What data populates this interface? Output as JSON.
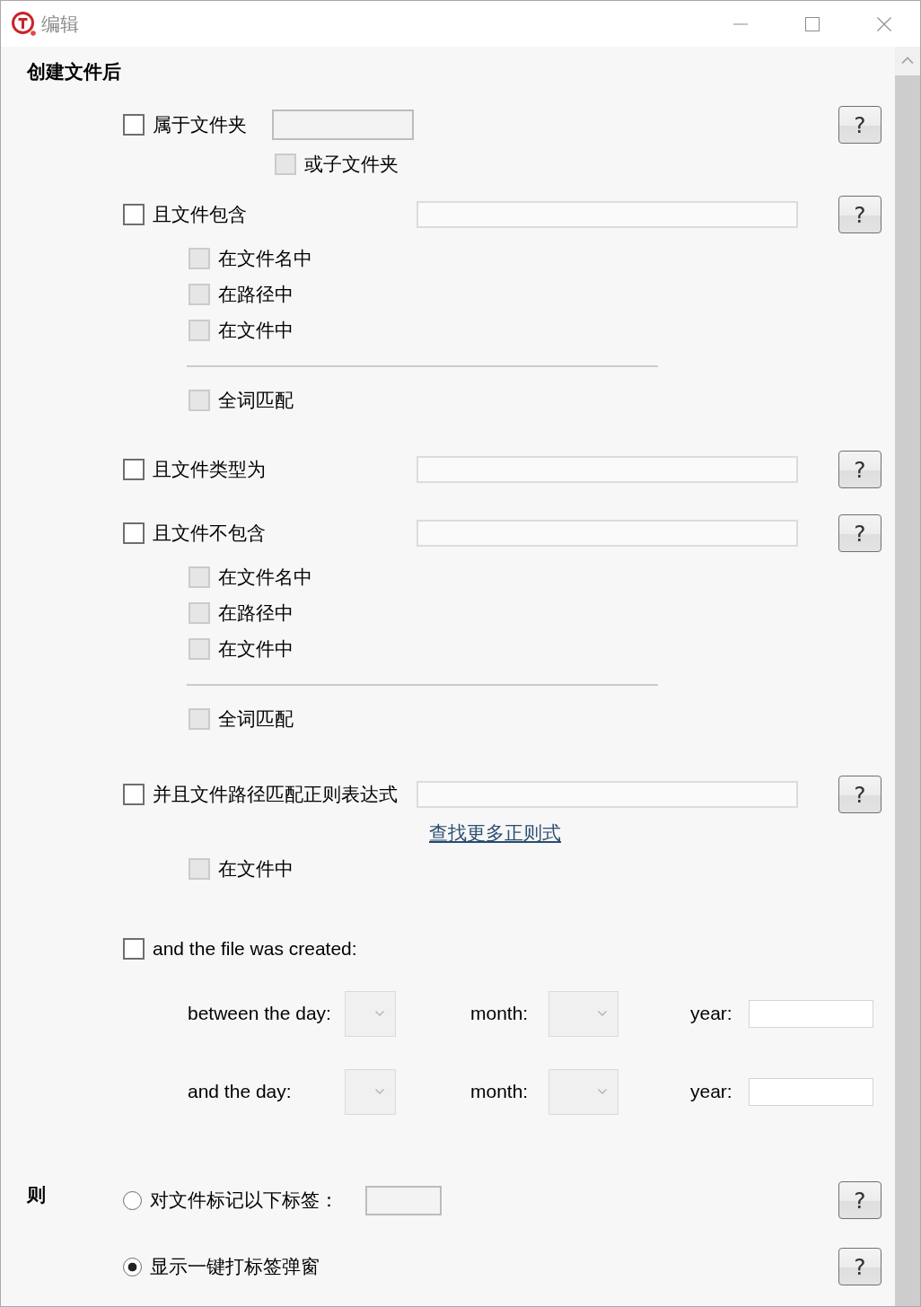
{
  "window": {
    "title": "编辑"
  },
  "created": {
    "heading": "创建文件后",
    "conditions": [
      {
        "kind": "folder",
        "label": "属于文件夹",
        "checked": false,
        "field": {
          "disabled": true
        },
        "help": "?",
        "subfolder": {
          "label": "或子文件夹",
          "checked": false,
          "disabled": true
        }
      },
      {
        "kind": "contains",
        "label": "且文件包含",
        "checked": false,
        "field": {
          "disabled": false
        },
        "help": "?",
        "options": [
          {
            "label": "在文件名中",
            "checked": false,
            "disabled": true
          },
          {
            "label": "在路径中",
            "checked": false,
            "disabled": true
          },
          {
            "label": "在文件中",
            "checked": false,
            "disabled": true
          }
        ],
        "whole_word": {
          "label": "全词匹配",
          "checked": false,
          "disabled": true
        }
      },
      {
        "kind": "type",
        "label": "且文件类型为",
        "checked": false,
        "field": {
          "disabled": false
        },
        "help": "?"
      },
      {
        "kind": "contains",
        "label": "且文件不包含",
        "checked": false,
        "field": {
          "disabled": false
        },
        "help": "?",
        "options": [
          {
            "label": "在文件名中",
            "checked": false,
            "disabled": true
          },
          {
            "label": "在路径中",
            "checked": false,
            "disabled": true
          },
          {
            "label": "在文件中",
            "checked": false,
            "disabled": true
          }
        ],
        "whole_word": {
          "label": "全词匹配",
          "checked": false,
          "disabled": true
        }
      },
      {
        "kind": "regex",
        "label": "并且文件路径匹配正则表达式",
        "checked": false,
        "field": {
          "disabled": false
        },
        "help": "?",
        "link": "查找更多正则式",
        "options": [
          {
            "label": "在文件中",
            "checked": false,
            "disabled": true
          }
        ]
      },
      {
        "kind": "date",
        "label": "and the file was created:",
        "checked": false,
        "ranges": [
          {
            "day": {
              "label": "between the day:",
              "disabled": true
            },
            "month": {
              "label": "month:",
              "disabled": true
            },
            "year": {
              "label": "year:"
            }
          },
          {
            "day": {
              "label": "and the day:",
              "disabled": true
            },
            "month": {
              "label": "month:",
              "disabled": true
            },
            "year": {
              "label": "year:"
            }
          }
        ]
      }
    ]
  },
  "then": {
    "heading": "则",
    "actions": [
      {
        "kind": "tag",
        "label": "对文件标记以下标签：",
        "selected": false,
        "field": {
          "disabled": true
        },
        "help": "?"
      },
      {
        "kind": "popup",
        "label": "显示一键打标签弹窗",
        "selected": true,
        "help": "?"
      }
    ]
  }
}
